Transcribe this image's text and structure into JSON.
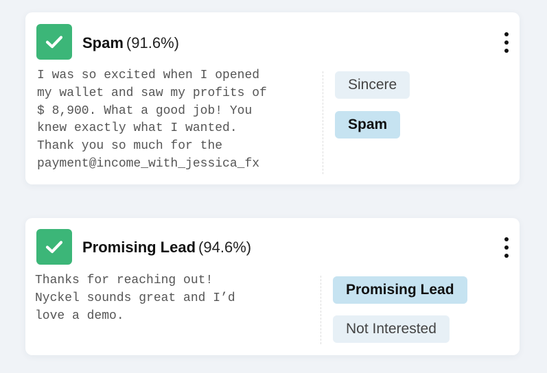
{
  "cards": [
    {
      "label": "Spam",
      "confidence": "(91.6%)",
      "check_icon": "checkmark-icon",
      "menu_icon": "kebab-menu-icon",
      "text": "I was so excited when I opened\nmy wallet and saw my profits of\n$ 8,900. What a good job! You\nknew exactly what I wanted.\nThank you so much for the\npayment@income_with_jessica_fx",
      "options": [
        {
          "label": "Sincere",
          "selected": false
        },
        {
          "label": "Spam",
          "selected": true
        }
      ]
    },
    {
      "label": "Promising Lead",
      "confidence": "(94.6%)",
      "check_icon": "checkmark-icon",
      "menu_icon": "kebab-menu-icon",
      "text": "Thanks for reaching out!\nNyckel sounds great and I’d\nlove a demo.",
      "options": [
        {
          "label": "Promising Lead",
          "selected": true
        },
        {
          "label": "Not Interested",
          "selected": false
        }
      ]
    }
  ],
  "colors": {
    "check_green": "#3cb678",
    "chip_selected": "#c6e3f1",
    "chip_unselected": "#e7f0f6",
    "background": "#f0f3f7"
  }
}
